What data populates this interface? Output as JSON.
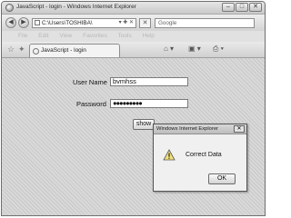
{
  "window": {
    "title": "JavaScript - login - Windows Internet Explorer",
    "controls": [
      "–",
      "□",
      "✕"
    ]
  },
  "navbar": {
    "back": "◀",
    "forward": "▶",
    "address": "C:\\Users\\TOSHIBA\\",
    "address_extra": "▾ ✚ ✕",
    "stop": "✕",
    "search_placeholder": "Google"
  },
  "menubar": {
    "items": [
      "File",
      "Edit",
      "View",
      "Favorites",
      "Tools",
      "Help"
    ]
  },
  "tabbar": {
    "tab_title": "JavaScript - login",
    "commands": [
      "⌂ ▾",
      "▣ ▾",
      "⎙ ▾"
    ]
  },
  "form": {
    "username_label": "User Name",
    "username_value": "bvmhss",
    "password_label": "Password",
    "password_value": "●●●●●●●●●",
    "show_button": "show"
  },
  "dialog": {
    "title": "Windows Internet Explorer",
    "close": "✕",
    "message": "Correct Data",
    "ok_button": "OK"
  }
}
